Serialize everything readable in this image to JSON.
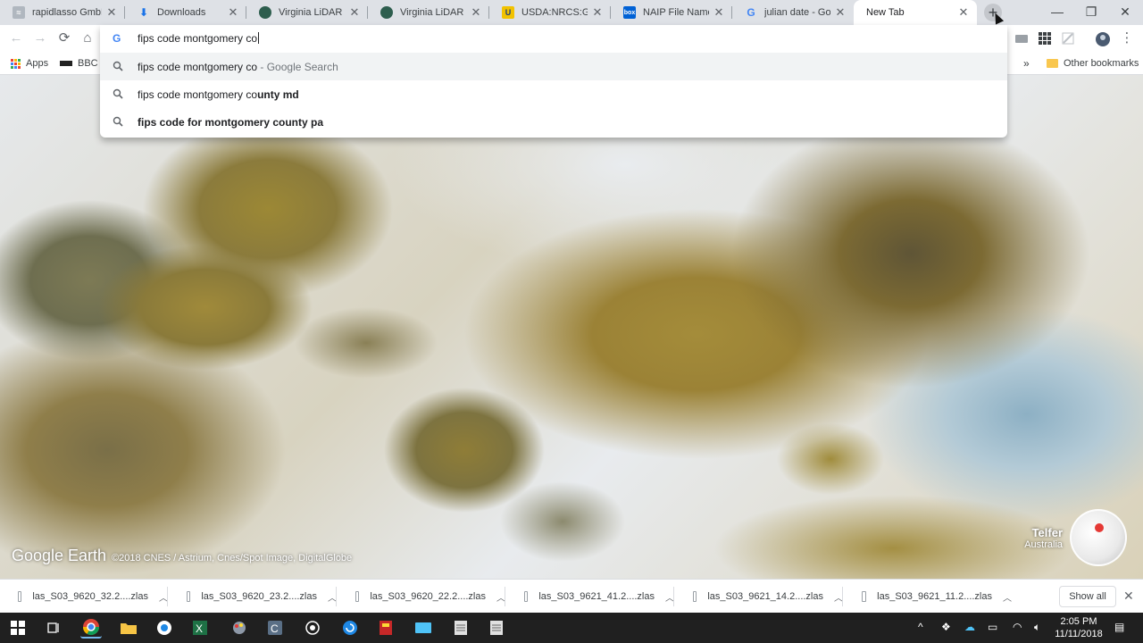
{
  "tabs": [
    {
      "title": "rapidlasso GmbH |",
      "icon": "rapidlasso-favicon"
    },
    {
      "title": "Downloads",
      "icon": "download-icon"
    },
    {
      "title": "Virginia LiDAR",
      "icon": "globe-favicon"
    },
    {
      "title": "Virginia LiDAR Dat",
      "icon": "globe-favicon"
    },
    {
      "title": "USDA:NRCS:Geosp",
      "icon": "usda-favicon"
    },
    {
      "title": "NAIP File Name.pc",
      "icon": "box-favicon"
    },
    {
      "title": "julian date - Goog",
      "icon": "google-favicon"
    },
    {
      "title": "New Tab",
      "icon": ""
    }
  ],
  "omnibox": {
    "typed": "fips code montgomery co",
    "suggestions": [
      {
        "text": "fips code montgomery co",
        "suffix": " - Google Search",
        "bold": ""
      },
      {
        "text": "fips code montgomery co",
        "suffix": "",
        "bold": "unty md"
      },
      {
        "text": "",
        "suffix": "",
        "bold": "fips code for montgomery county pa"
      }
    ]
  },
  "bookmarks": {
    "apps": "Apps",
    "bbc": "BBC C",
    "more": "»",
    "other": "Other bookmarks"
  },
  "earth": {
    "logo": "Google Earth",
    "credit": "©2018 CNES / Astrium, Cnes/Spot Image, DigitalGlobe",
    "place": "Telfer",
    "country": "Australia"
  },
  "downloads": [
    {
      "name": "las_S03_9620_32.2....zlas"
    },
    {
      "name": "las_S03_9620_23.2....zlas"
    },
    {
      "name": "las_S03_9620_22.2....zlas"
    },
    {
      "name": "las_S03_9621_41.2....zlas"
    },
    {
      "name": "las_S03_9621_14.2....zlas"
    },
    {
      "name": "las_S03_9621_11.2....zlas"
    }
  ],
  "download_controls": {
    "show_all": "Show all",
    "close": "✕"
  },
  "taskbar": {
    "time": "2:05 PM",
    "date": "11/11/2018"
  },
  "colors": {
    "accent": "#1a73e8",
    "tab_strip": "#dee1e6",
    "taskbar": "#202020"
  }
}
